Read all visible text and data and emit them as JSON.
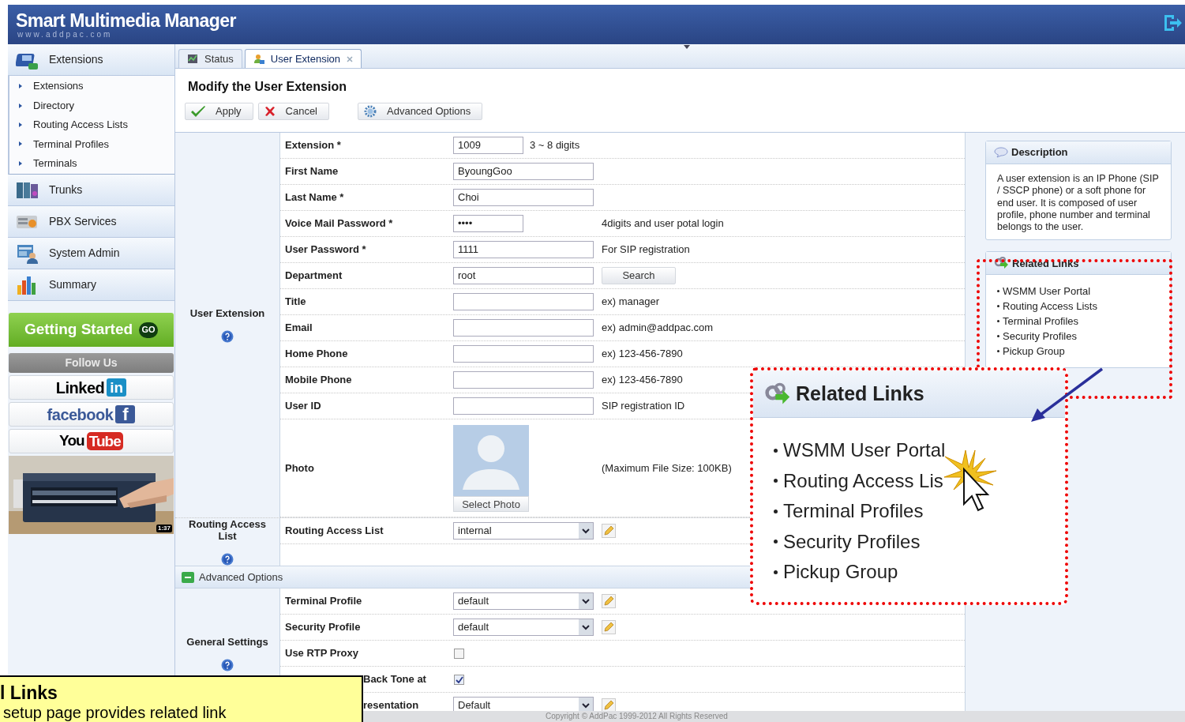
{
  "header": {
    "title": "Smart Multimedia Manager",
    "subtitle": "www.addpac.com"
  },
  "sidebar": {
    "sections": [
      {
        "label": "Extensions",
        "children": [
          "Extensions",
          "Directory",
          "Routing Access Lists",
          "Terminal Profiles",
          "Terminals"
        ]
      },
      {
        "label": "Trunks"
      },
      {
        "label": "PBX Services"
      },
      {
        "label": "System Admin"
      },
      {
        "label": "Summary"
      }
    ],
    "getting_started": {
      "label": "Getting Started",
      "badge": "GO"
    },
    "follow_us": {
      "title": "Follow Us",
      "links": [
        {
          "kind": "linkedin",
          "text": "Linked",
          "logo": "in"
        },
        {
          "kind": "facebook",
          "text": "facebook",
          "logo": "f"
        },
        {
          "kind": "youtube",
          "text": "You",
          "logo": "Tube"
        }
      ]
    },
    "video": {
      "kind": "picture",
      "duration": "1:37"
    }
  },
  "tabs": [
    {
      "label": "Status",
      "selected": false
    },
    {
      "label": "User Extension",
      "selected": true
    }
  ],
  "page_title": "Modify the User Extension",
  "toolbar": [
    {
      "kind": "apply",
      "label": "Apply"
    },
    {
      "kind": "cancel",
      "label": "Cancel"
    },
    {
      "kind": "advanced",
      "label": "Advanced Options"
    }
  ],
  "sections": [
    {
      "title": "User Extension",
      "rows": [
        {
          "kind": "short",
          "label": "Extension *",
          "value": "1009",
          "hint": "3 ~ 8 digits"
        },
        {
          "kind": "text",
          "label": "First Name",
          "value": "ByoungGoo"
        },
        {
          "kind": "text",
          "label": "Last Name *",
          "value": "Choi"
        },
        {
          "kind": "password",
          "label": "Voice Mail Password *",
          "value": "••••",
          "hint": "4digits and user potal login"
        },
        {
          "kind": "text",
          "label": "User Password *",
          "value": "1111",
          "hint": "For SIP registration"
        },
        {
          "kind": "text",
          "label": "Department",
          "value": "root",
          "button": "Search"
        },
        {
          "kind": "text",
          "label": "Title",
          "hint": "ex) manager"
        },
        {
          "kind": "text",
          "label": "Email",
          "hint": "ex) admin@addpac.com"
        },
        {
          "kind": "text",
          "label": "Home Phone",
          "hint": "ex) 123-456-7890"
        },
        {
          "kind": "text",
          "label": "Mobile Phone",
          "hint": "ex) 123-456-7890"
        },
        {
          "kind": "text",
          "label": "User ID",
          "hint": "SIP registration ID"
        },
        {
          "label": "Photo",
          "button": "Select Photo",
          "hint": "(Maximum File Size: 100KB)"
        }
      ]
    },
    {
      "title": "Routing Access List",
      "rows": [
        {
          "kind": "select",
          "label": "Routing Access List",
          "value": "internal"
        }
      ]
    }
  ],
  "advanced_options": {
    "label": "Advanced Options",
    "sections": [
      {
        "title": "General Settings",
        "rows": [
          {
            "kind": "select",
            "label": "Terminal Profile",
            "value": "default"
          },
          {
            "kind": "select",
            "label": "Security Profile",
            "value": "default"
          },
          {
            "kind": "checkbox",
            "label": "Use RTP Proxy",
            "checked": false
          },
          {
            "kind": "checkbox",
            "label": "Back Tone at",
            "checked": true
          },
          {
            "kind": "select",
            "label": "resentation",
            "value": "Default"
          }
        ]
      }
    ]
  },
  "description": {
    "title": "Description",
    "text": "A user extension is an IP Phone (SIP / SSCP phone) or a soft phone for end user. It is composed of user profile, phone number and terminal belongs to the user."
  },
  "related_links": {
    "title": "Related Links",
    "items": [
      "WSMM User Portal",
      "Routing Access Lists",
      "Terminal Profiles",
      "Security Profiles",
      "Pickup Group"
    ]
  },
  "zoom_callout": {
    "title": "Related Links",
    "items": [
      "WSMM User Portal",
      "Routing Access Lis",
      "Terminal Profiles",
      "Security Profiles",
      "Pickup Group"
    ]
  },
  "note": {
    "title": "l Links",
    "text": "setup page provides related link"
  },
  "footer": "Copyright © AddPac 1999-2012 All Rights Reserved"
}
